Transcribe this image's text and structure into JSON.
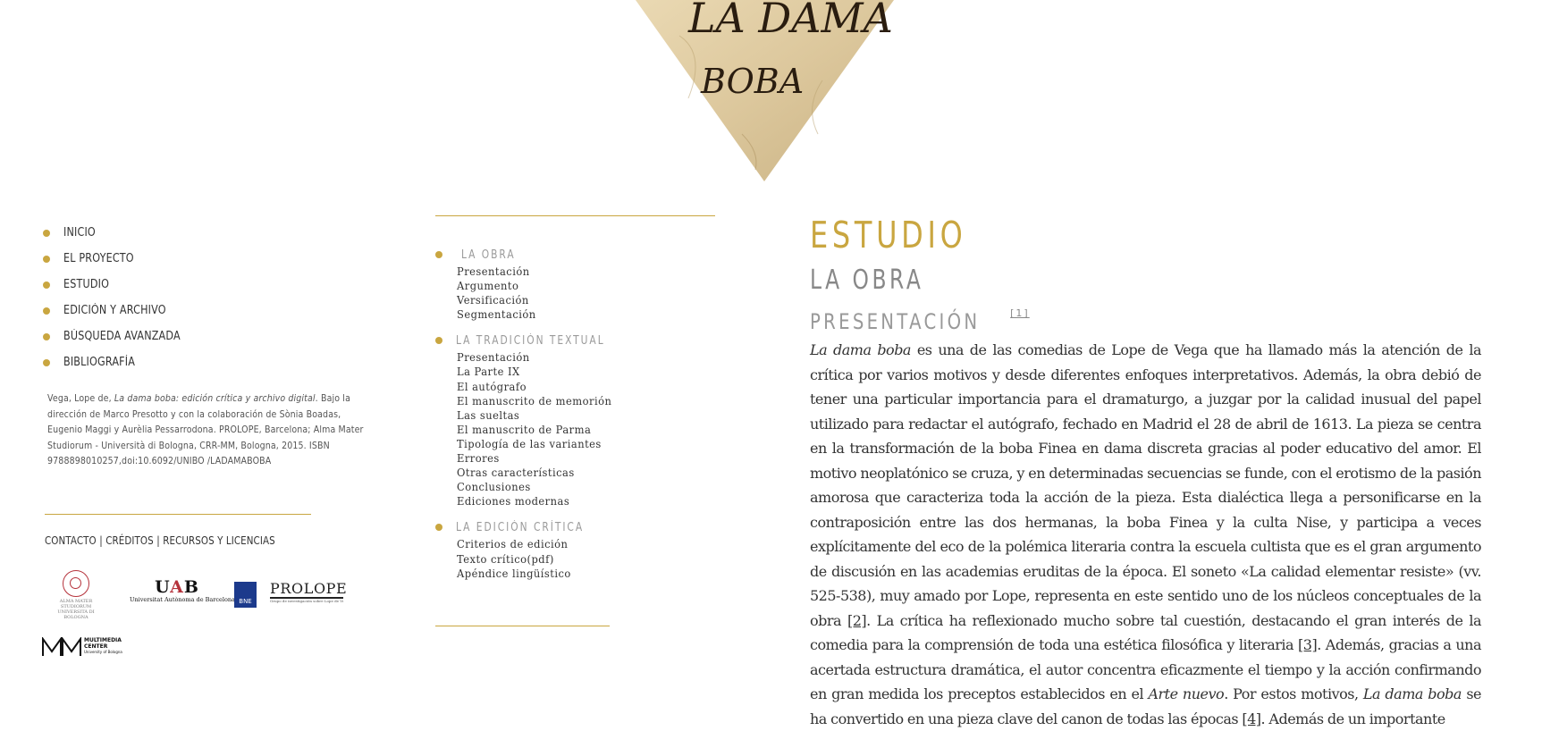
{
  "header": {
    "image_lines": [
      "LA DAMA",
      "BOBA"
    ]
  },
  "nav": {
    "items": [
      {
        "label": "INICIO"
      },
      {
        "label": "EL PROYECTO"
      },
      {
        "label": "ESTUDIO"
      },
      {
        "label": "EDICIÓN Y ARCHIVO"
      },
      {
        "label": "BÚSQUEDA AVANZADA"
      },
      {
        "label": "BIBLIOGRAFÍA"
      }
    ]
  },
  "citation": {
    "author": "Vega, Lope de,",
    "title": "La dama boba: edición crítica y archivo digital",
    "rest": ". Bajo la dirección de Marco Presotto y con la colaboración de Sònia Boadas, Eugenio Maggi y Aurèlia Pessarrodona. PROLOPE, Barcelona; Alma Mater Studiorum - Università di Bologna, CRR-MM, Bologna, 2015. ISBN 9788898010257,doi:10.6092/UNIBO /LADAMABOBA"
  },
  "footer_links": {
    "contacto": "CONTACTO",
    "creditos": "CRÉDITOS",
    "recursos": "RECURSOS Y LICENCIAS",
    "separator": "|"
  },
  "logos": {
    "unibo_caption_1": "ALMA MATER STUDIORUM",
    "unibo_caption_2": "UNIVERSITÀ DI BOLOGNA",
    "uab_mark_1": "U",
    "uab_mark_2": "A",
    "uab_mark_3": "B",
    "uab_caption": "Universitat Autònoma de Barcelona",
    "bne": "BNE",
    "prolope": "PROLOPE",
    "prolope_caption": "Grupo de investigación sobre Lope de Vega de la Universitat Autònoma de Barcelona",
    "mmc_line1": "MULTIMEDIA",
    "mmc_line2": "CENTER",
    "mmc_line3": "University of Bologna"
  },
  "toc": {
    "sections": [
      {
        "title": "LA OBRA",
        "items": [
          "Presentación",
          "Argumento",
          "Versificación",
          "Segmentación"
        ]
      },
      {
        "title": "LA TRADICIÓN TEXTUAL",
        "items": [
          "Presentación",
          "La Parte IX",
          "El autógrafo",
          "El manuscrito de memorión",
          "Las sueltas",
          "El manuscrito de Parma",
          "Tipología de las variantes",
          "Errores",
          "Otras características",
          "Conclusiones",
          "Ediciones modernas"
        ]
      },
      {
        "title": "LA EDICIÓN CRÍTICA",
        "items": [
          "Criterios de edición",
          "Texto crítico(pdf)",
          "Apéndice lingüístico"
        ]
      }
    ]
  },
  "article": {
    "section_title": "ESTUDIO",
    "subsection_title": "LA OBRA",
    "heading": "PRESENTACIÓN",
    "heading_footnote": "[1]",
    "p1_title": "La dama boba",
    "p1_a": " es una de las comedias de Lope de Vega que ha llamado más la atención de la crítica por varios motivos y desde diferentes enfoques interpretativos. Además, la obra debió de tener una particular importancia para el dramaturgo, a juzgar por la calidad inusual del papel utilizado para redactar el autógrafo, fechado en Madrid el 28 de abril de 1613. La pieza se centra en la transformación de la boba Finea en dama discreta gracias al poder educativo del amor. El motivo neoplatónico se cruza, y en determinadas secuencias se funde, con el erotismo de la pasión amorosa que caracteriza toda la acción de la pieza. Esta dialéctica llega a personificarse en la contraposición entre las dos hermanas, la boba Finea y la culta Nise, y participa a veces explícitamente del eco de la polémica literaria contra la escuela cultista que es el gran argumento de discusión en las academias eruditas de la época. El soneto «La calidad elementar resiste» (vv. 525-538), muy amado por Lope, representa en este sentido uno de los núcleos conceptuales de la obra ",
    "fn2": "[2]",
    "p1_b": ". La crítica ha reflexionado mucho sobre tal cuestión, destacando el gran interés de la comedia para la comprensión de toda una estética filosófica y literaria ",
    "fn3": "[3]",
    "p1_c": ". Además, gracias a una acertada estructura dramática, el autor concentra eficazmente el tiempo y la acción confirmando en gran medida los preceptos establecidos en el ",
    "arte_nuevo": "Arte nuevo",
    "p1_d": ". Por estos motivos, ",
    "p1_title2": "La dama boba",
    "p1_e": " se ha convertido en una pieza clave del canon de todas las épocas ",
    "fn4": "[4]",
    "p1_f": ". Además de un importante"
  },
  "colors": {
    "accent_gold": "#c9a640",
    "text": "#333333",
    "muted_heading": "#999999"
  }
}
